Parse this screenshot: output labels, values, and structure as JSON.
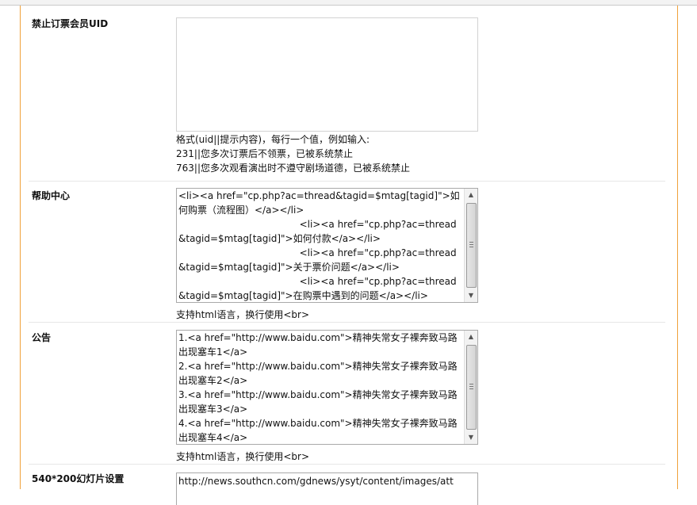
{
  "fields": {
    "ban_uid": {
      "label": "禁止订票会员UID",
      "hint_lines": [
        "格式(uid||提示内容)，每行一个值，例如输入:",
        "231||您多次订票后不领票，已被系统禁止",
        "763||您多次观看演出时不遵守剧场道德，已被系统禁止"
      ]
    },
    "help_center": {
      "label": "帮助中心",
      "content": "<li><a href=\"cp.php?ac=thread&tagid=$mtag[tagid]\">如何购票（流程图）</a></li>\n                                        <li><a href=\"cp.php?ac=thread&tagid=$mtag[tagid]\">如何付款</a></li>\n                                        <li><a href=\"cp.php?ac=thread&tagid=$mtag[tagid]\">关于票价问题</a></li>\n                                        <li><a href=\"cp.php?ac=thread&tagid=$mtag[tagid]\">在购票中遇到的问题</a></li>",
      "hint": "支持html语言，换行使用<br>"
    },
    "notice": {
      "label": "公告",
      "content": "1.<a href=\"http://www.baidu.com\">精神失常女子裸奔致马路出现塞车1</a>\n2.<a href=\"http://www.baidu.com\">精神失常女子裸奔致马路出现塞车2</a>\n3.<a href=\"http://www.baidu.com\">精神失常女子裸奔致马路出现塞车3</a>\n4.<a href=\"http://www.baidu.com\">精神失常女子裸奔致马路出现塞车4</a>",
      "hint": "支持html语言，换行使用<br>"
    },
    "slideshow": {
      "label": "540*200幻灯片设置",
      "content": "http://news.southcn.com/gdnews/ysyt/content/images/att"
    }
  },
  "icons": {
    "scroll_up": "▲",
    "scroll_down": "▼"
  }
}
